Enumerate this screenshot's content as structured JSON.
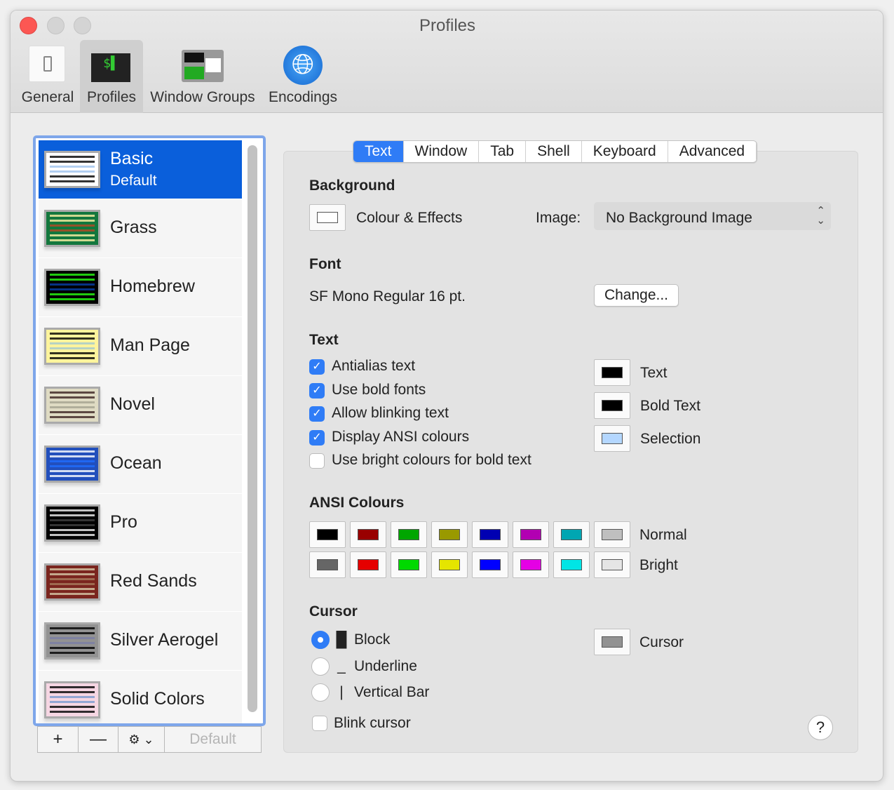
{
  "window": {
    "title": "Profiles"
  },
  "toolbar": [
    {
      "label": "General",
      "icon": "switch-icon"
    },
    {
      "label": "Profiles",
      "icon": "terminal-icon",
      "selected": true
    },
    {
      "label": "Window Groups",
      "icon": "window-groups-icon"
    },
    {
      "label": "Encodings",
      "icon": "globe-icon"
    }
  ],
  "profiles": [
    {
      "name": "Basic",
      "sub": "Default",
      "bg": "#ffffff",
      "fg": "#000000",
      "hl": "#9fc3ee",
      "selected": true
    },
    {
      "name": "Grass",
      "bg": "#13773d",
      "fg": "#fff0a5",
      "hl": "#b64926"
    },
    {
      "name": "Homebrew",
      "bg": "#000000",
      "fg": "#28fe14",
      "hl": "#083fa6"
    },
    {
      "name": "Man Page",
      "bg": "#fef49c",
      "fg": "#000000",
      "hl": "#a4c9cd"
    },
    {
      "name": "Novel",
      "bg": "#dfdbc3",
      "fg": "#3b2322",
      "hl": "#a4a390"
    },
    {
      "name": "Ocean",
      "bg": "#224fbc",
      "fg": "#ffffff",
      "hl": "#216dff"
    },
    {
      "name": "Pro",
      "bg": "#000000",
      "fg": "#f2f2f2",
      "hl": "#414141"
    },
    {
      "name": "Red Sands",
      "bg": "#7a251e",
      "fg": "#d7c9a7",
      "hl": "#a77c5d"
    },
    {
      "name": "Silver Aerogel",
      "bg": "#929292",
      "fg": "#000000",
      "hl": "#7b7ea5"
    },
    {
      "name": "Solid Colors",
      "bg": "#f6d6e3",
      "fg": "#000000",
      "hl": "#7b9bd0"
    }
  ],
  "list_buttons": {
    "add": "+",
    "remove": "—",
    "default": "Default"
  },
  "tabs": [
    {
      "label": "Text",
      "selected": true
    },
    {
      "label": "Window"
    },
    {
      "label": "Tab"
    },
    {
      "label": "Shell"
    },
    {
      "label": "Keyboard"
    },
    {
      "label": "Advanced"
    }
  ],
  "background": {
    "heading": "Background",
    "colour_effects": "Colour & Effects",
    "image_label": "Image:",
    "image_value": "No Background Image"
  },
  "font": {
    "heading": "Font",
    "value": "SF Mono Regular 16 pt.",
    "change": "Change..."
  },
  "text": {
    "heading": "Text",
    "options": [
      {
        "label": "Antialias text",
        "checked": true
      },
      {
        "label": "Use bold fonts",
        "checked": true
      },
      {
        "label": "Allow blinking text",
        "checked": true
      },
      {
        "label": "Display ANSI colours",
        "checked": true
      },
      {
        "label": "Use bright colours for bold text",
        "checked": false
      }
    ],
    "colors": [
      {
        "label": "Text",
        "color": "#000000"
      },
      {
        "label": "Bold Text",
        "color": "#000000"
      },
      {
        "label": "Selection",
        "color": "#b4d7ff"
      }
    ]
  },
  "ansi": {
    "heading": "ANSI Colours",
    "normal_label": "Normal",
    "bright_label": "Bright",
    "normal": [
      "#000000",
      "#990000",
      "#00a600",
      "#999900",
      "#0000b2",
      "#b200b2",
      "#00a6b2",
      "#bfbfbf"
    ],
    "bright": [
      "#666666",
      "#e50000",
      "#00d900",
      "#e5e500",
      "#0000ff",
      "#e500e5",
      "#00e5e5",
      "#e5e5e5"
    ]
  },
  "cursor": {
    "heading": "Cursor",
    "options": [
      {
        "label": "Block",
        "glyph": "█",
        "selected": true
      },
      {
        "label": "Underline",
        "glyph": "_"
      },
      {
        "label": "Vertical Bar",
        "glyph": "|"
      }
    ],
    "blink": "Blink cursor",
    "blink_checked": false,
    "color_label": "Cursor",
    "color": "#929292"
  },
  "help": "?"
}
